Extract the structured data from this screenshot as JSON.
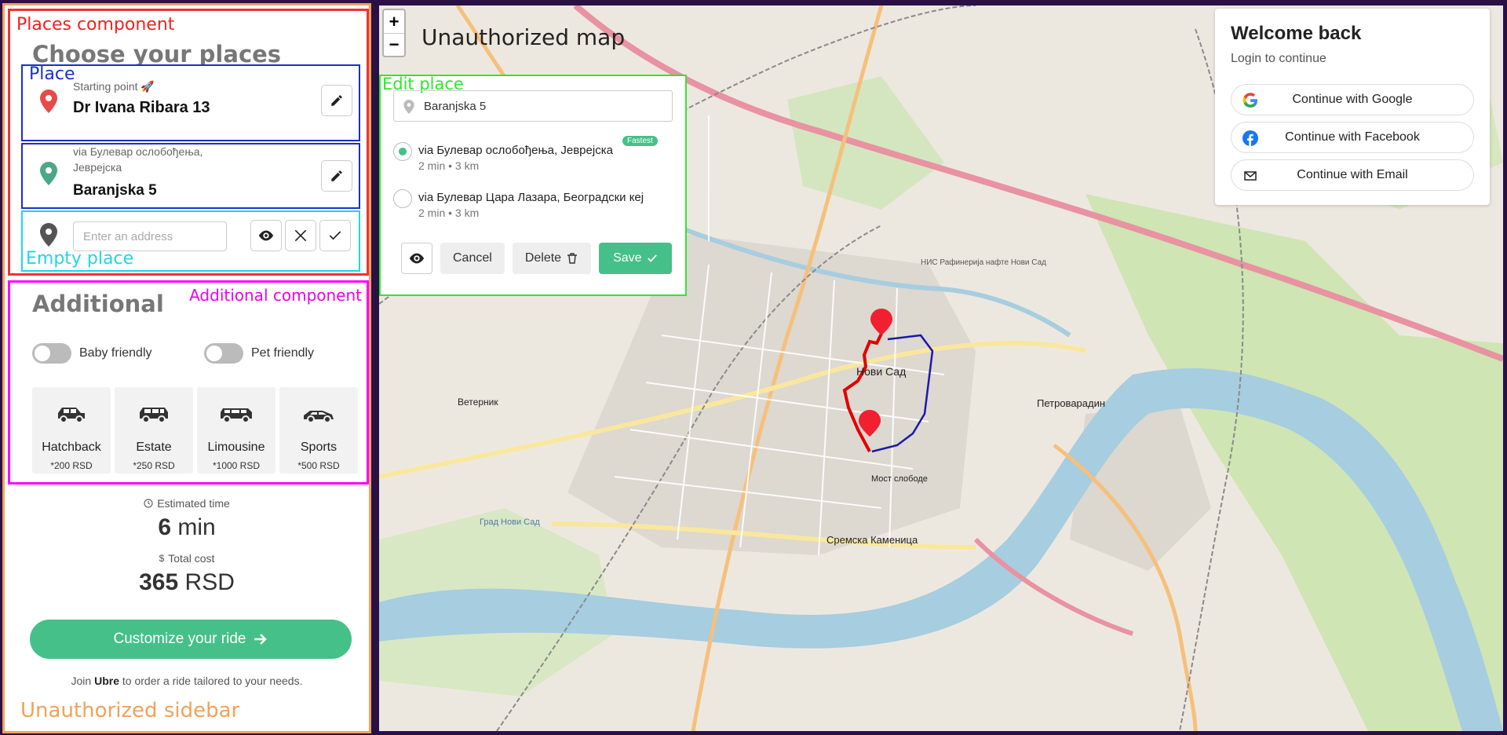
{
  "sidebar": {
    "debug_label": "Unauthorized sidebar",
    "places": {
      "debug_label": "Places component",
      "title": "Choose your places",
      "place_debug_label": "Place",
      "empty_debug_label": "Empty place",
      "items": [
        {
          "subtitle": "Starting point 🚀",
          "name": "Dr Ivana Ribara 13",
          "pin_color": "#e84a4a"
        },
        {
          "subtitle": "via Булевар ослобођења, Јеврејска",
          "name": "Baranjska 5",
          "pin_color": "#4aa888"
        }
      ],
      "empty": {
        "placeholder": "Enter an address",
        "pin_color": "#555555"
      }
    },
    "additional": {
      "debug_label": "Additional component",
      "title": "Additional",
      "toggles": [
        {
          "label": "Baby friendly",
          "on": false
        },
        {
          "label": "Pet friendly",
          "on": false
        }
      ],
      "vehicles": [
        {
          "name": "Hatchback",
          "price": "*200 RSD"
        },
        {
          "name": "Estate",
          "price": "*250 RSD"
        },
        {
          "name": "Limousine",
          "price": "*1000 RSD"
        },
        {
          "name": "Sports",
          "price": "*500 RSD"
        }
      ]
    },
    "estimates": {
      "time_label": "Estimated time",
      "time_value": "6",
      "time_unit": "min",
      "cost_label": "Total cost",
      "cost_value": "365",
      "cost_unit": "RSD"
    },
    "cta_label": "Customize your ride",
    "join": {
      "prefix": "Join",
      "brand": "Ubre",
      "suffix": "to order a ride tailored to your needs."
    }
  },
  "map": {
    "title": "Unauthorized map",
    "zoom_in": "+",
    "zoom_out": "−",
    "labels": {
      "city": "Нови Сад",
      "petrovaradin": "Петроварадин",
      "veternik": "Ветерник",
      "sremska": "Сремска Каменица",
      "most": "Мост слободе",
      "grad": "Град Нови Сад",
      "nis": "НИС Рафинерија нафте Нови Сад"
    },
    "accent_route": "#e00000",
    "alt_route": "#1a1aa8"
  },
  "edit_place": {
    "debug_label": "Edit place",
    "value": "Baranjska 5",
    "routes": [
      {
        "name": "via Булевар ослобођења, Јеврејска",
        "meta": "2 min • 3 km",
        "badge": "Fastest",
        "selected": true
      },
      {
        "name": "via Булевар Цара Лазара, Београдски кеј",
        "meta": "2 min • 3 km",
        "selected": false
      }
    ],
    "cancel": "Cancel",
    "delete": "Delete",
    "save": "Save"
  },
  "login": {
    "title": "Welcome back",
    "subtitle": "Login to continue",
    "google": "Continue with Google",
    "facebook": "Continue with Facebook",
    "email": "Continue with Email"
  },
  "colors": {
    "brand": "#45c088"
  }
}
